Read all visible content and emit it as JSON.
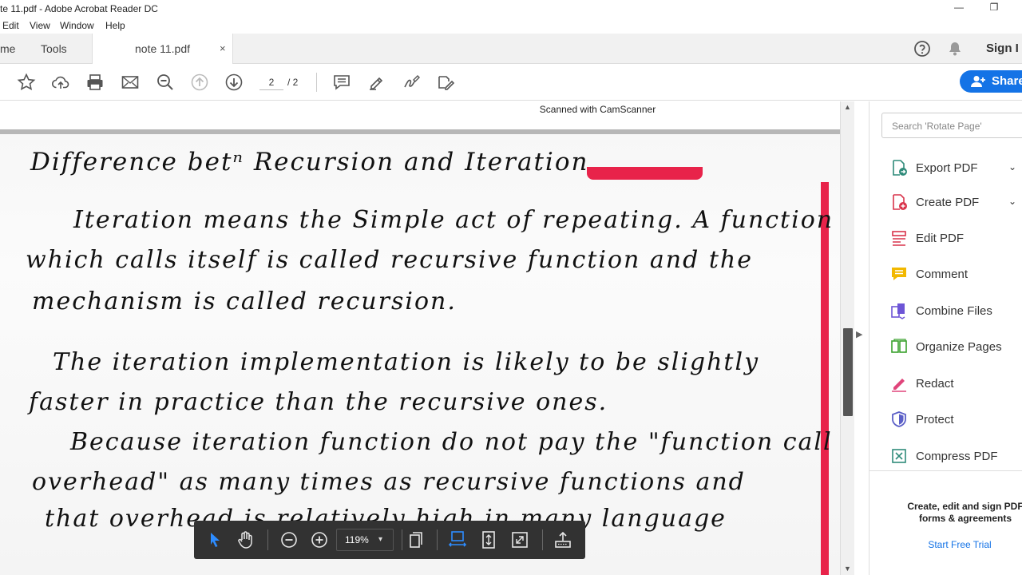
{
  "window": {
    "title": "te 11.pdf - Adobe Acrobat Reader DC",
    "minimize": "—",
    "restore": "❐"
  },
  "menu": [
    "Edit",
    "View",
    "Window",
    "Help"
  ],
  "tabs": {
    "home": "me",
    "tools": "Tools",
    "document": "note 11.pdf",
    "close": "×"
  },
  "header": {
    "signin": "Sign I"
  },
  "toolbar": {
    "page_current": "2",
    "page_total": "/ 2",
    "share_label": "Share"
  },
  "document": {
    "scanned_label": "Scanned with CamScanner",
    "lines": [
      "Difference betⁿ Recursion and Iteration",
      "Iteration means the Simple act of repeating. A function",
      "which calls itself is called recursive function and the",
      "mechanism is called recursion.",
      "The iteration implementation is likely to be slightly",
      "faster in practice than the recursive ones.",
      "Because iteration function do not pay the \"function call",
      "overhead\" as many times as recursive functions and",
      "that overhead is relatively high in many language"
    ]
  },
  "right_panel": {
    "search_placeholder": "Search 'Rotate Page'",
    "items": [
      {
        "label": "Export PDF",
        "chev": "⌄"
      },
      {
        "label": "Create PDF",
        "chev": "⌄"
      },
      {
        "label": "Edit PDF"
      },
      {
        "label": "Comment"
      },
      {
        "label": "Combine Files"
      },
      {
        "label": "Organize Pages"
      },
      {
        "label": "Redact"
      },
      {
        "label": "Protect"
      },
      {
        "label": "Compress PDF"
      }
    ],
    "promo_line1": "Create, edit and sign PDF",
    "promo_line2": "forms & agreements",
    "trial_link": "Start Free Trial"
  },
  "floating_toolbar": {
    "zoom": "119%",
    "zoom_dropdown": "▾"
  },
  "colors": {
    "accent": "#1473e6",
    "floatbar_bg": "#323232",
    "red_margin": "#e8234a"
  }
}
